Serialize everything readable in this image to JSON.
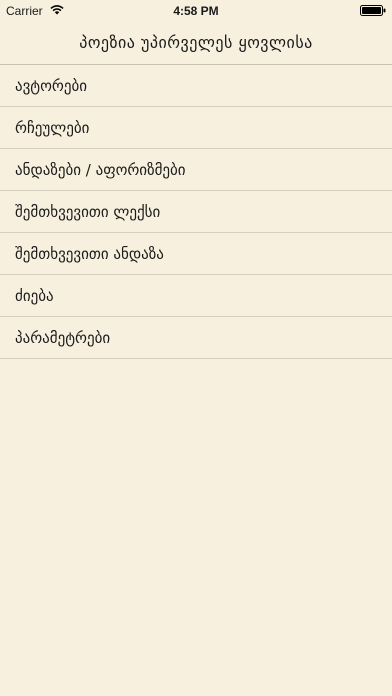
{
  "status_bar": {
    "carrier": "Carrier",
    "time": "4:58 PM",
    "wifi_icon": "wifi-icon",
    "battery_icon": "battery-icon"
  },
  "nav": {
    "title": "პოეზია უპირველეს ყოვლისა"
  },
  "menu": {
    "items": [
      {
        "label": "ავტორები"
      },
      {
        "label": "რჩეულები"
      },
      {
        "label": "ანდაზები / აფორიზმები"
      },
      {
        "label": "შემთხვევითი ლექსი"
      },
      {
        "label": "შემთხვევითი ანდაზა"
      },
      {
        "label": "ძიება"
      },
      {
        "label": "პარამეტრები"
      }
    ]
  },
  "colors": {
    "background": "#f7f0df",
    "separator": "#d6cfbf",
    "text": "#1a1a1a"
  }
}
